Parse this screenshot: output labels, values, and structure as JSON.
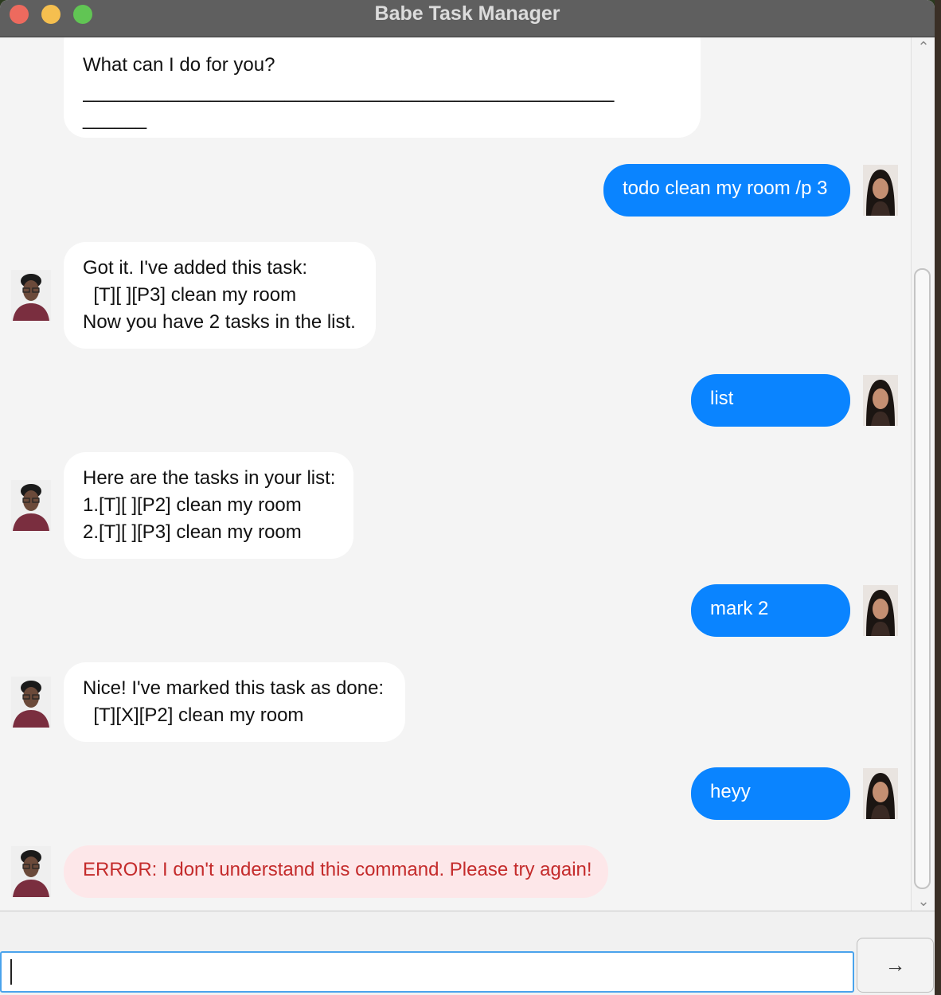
{
  "window": {
    "title": "Babe Task Manager"
  },
  "messages": [
    {
      "sender": "bot",
      "lines": [
        "What can I do for you?",
        "__________________________________________________",
        "______"
      ]
    },
    {
      "sender": "user",
      "lines": [
        "todo clean my room /p 3"
      ]
    },
    {
      "sender": "bot",
      "lines": [
        "Got it. I've added this task:",
        "  [T][ ][P3] clean my room",
        "Now you have 2 tasks in the list."
      ]
    },
    {
      "sender": "user",
      "lines": [
        "list"
      ]
    },
    {
      "sender": "bot",
      "lines": [
        "Here are the tasks in your list:",
        "1.[T][ ][P2] clean my room",
        "2.[T][ ][P3] clean my room"
      ]
    },
    {
      "sender": "user",
      "lines": [
        "mark 2"
      ]
    },
    {
      "sender": "bot",
      "lines": [
        "Nice! I've marked this task as done:",
        "  [T][X][P2] clean my room"
      ]
    },
    {
      "sender": "user",
      "lines": [
        "heyy"
      ]
    },
    {
      "sender": "bot",
      "error": true,
      "lines": [
        "ERROR: I don't understand this command. Please try again!"
      ]
    }
  ],
  "input": {
    "value": "",
    "placeholder": ""
  },
  "icons": {
    "send": "arrow-right-icon",
    "scroll_up": "chevron-up-icon",
    "scroll_down": "chevron-down-icon"
  },
  "colors": {
    "user_bubble": "#0a84ff",
    "bot_bubble": "#ffffff",
    "error_bubble": "#fde7e9",
    "error_text": "#c42b2b"
  }
}
